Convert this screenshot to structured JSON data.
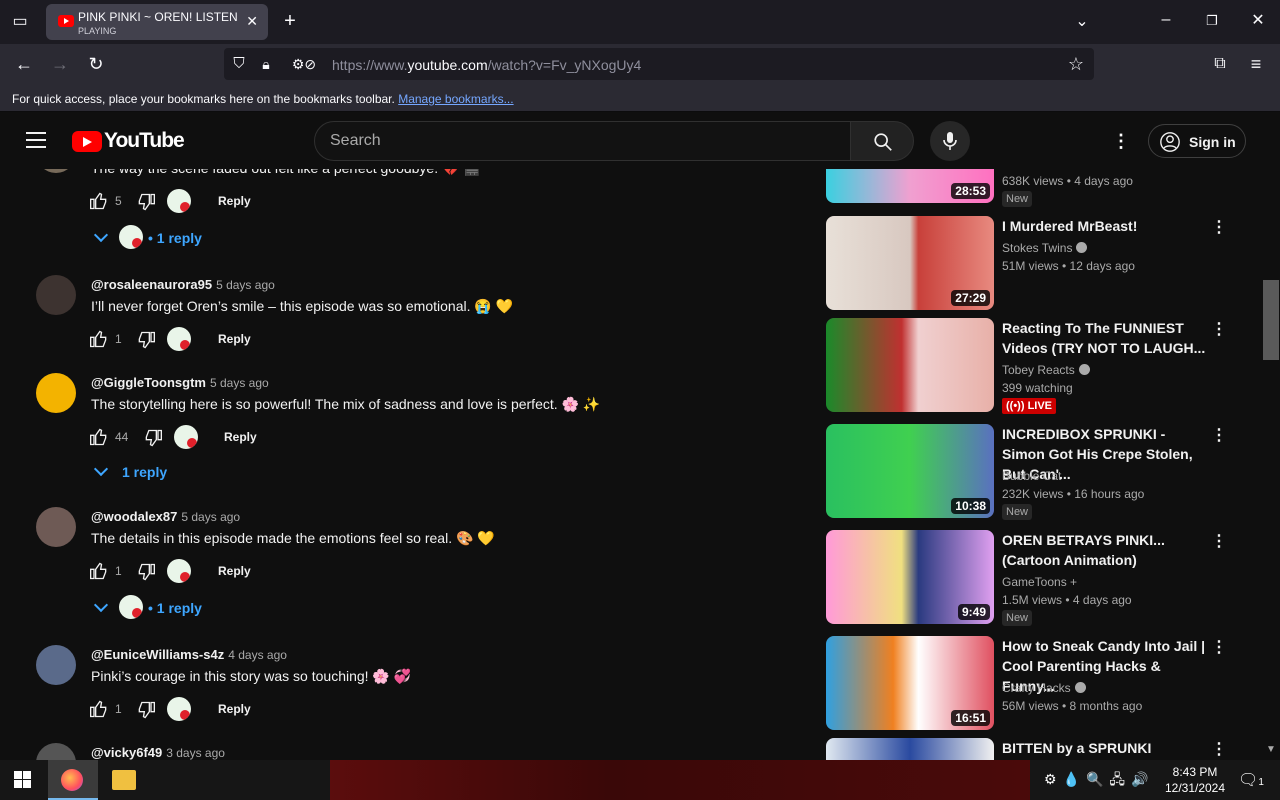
{
  "browser": {
    "tab": {
      "title": "PINK PINKI ~ OREN! LISTEN To",
      "status": "PLAYING"
    },
    "url": {
      "prefix": "https://www.",
      "domain": "youtube.com",
      "path": "/watch?v=Fv_yNXogUy4"
    },
    "bookmarks": {
      "text": "For quick access, place your bookmarks here on the bookmarks toolbar.",
      "link": "Manage bookmarks..."
    }
  },
  "header": {
    "logo": "YouTube",
    "search_placeholder": "Search",
    "signin": "Sign in"
  },
  "comments": [
    {
      "text": "The way the scene faded out felt like a perfect goodbye. 💔 🎬",
      "likes": "5",
      "reply_label": "Reply",
      "replies": "1 reply"
    },
    {
      "handle": "@rosaleenaurora95",
      "ago": "5 days ago",
      "text": "I’ll never forget Oren’s smile – this episode was so emotional. 😭 💛",
      "likes": "1",
      "reply_label": "Reply"
    },
    {
      "handle": "@GiggleToonsgtm",
      "ago": "5 days ago",
      "text": "The storytelling here is so powerful! The mix of sadness and love is perfect. 🌸 ✨",
      "likes": "44",
      "reply_label": "Reply",
      "replies": "1 reply"
    },
    {
      "handle": "@woodalex87",
      "ago": "5 days ago",
      "text": "The details in this episode made the emotions feel so real. 🎨 💛",
      "likes": "1",
      "reply_label": "Reply",
      "replies": "1 reply"
    },
    {
      "handle": "@EuniceWilliams-s4z",
      "ago": "4 days ago",
      "text": "Pinki’s courage in this story was so touching! 🌸 💞",
      "likes": "1",
      "reply_label": "Reply"
    },
    {
      "handle": "@vicky6f49",
      "ago": "3 days ago"
    }
  ],
  "sidebar": [
    {
      "duration": "28:53",
      "meta": "638K views • 4 days ago",
      "badge": "New"
    },
    {
      "title": "I Murdered MrBeast!",
      "channel": "Stokes Twins",
      "meta": "51M views • 12 days ago",
      "duration": "27:29"
    },
    {
      "title": "Reacting To The FUNNIEST Videos (TRY NOT TO LAUGH...",
      "channel": "Tobey Reacts",
      "meta": "399 watching",
      "live": "LIVE"
    },
    {
      "title": "INCREDIBOX SPRUNKI - Simon Got His Crepe Stolen, But Can'...",
      "channel": "Bubble Cat",
      "meta": "232K views • 16 hours ago",
      "duration": "10:38",
      "badge": "New"
    },
    {
      "title": "OREN BETRAYS PINKI... (Cartoon Animation)",
      "channel": "GameToons +",
      "meta": "1.5M views • 4 days ago",
      "duration": "9:49",
      "badge": "New"
    },
    {
      "title": "How to Sneak Candy Into Jail | Cool Parenting Hacks & Funny...",
      "channel": "Crafty Hacks",
      "meta": "56M views • 8 months ago",
      "duration": "16:51"
    },
    {
      "title": "BITTEN by a SPRUNKI SPIDER"
    }
  ],
  "taskbar": {
    "time": "8:43 PM",
    "date": "12/31/2024",
    "notif": "1"
  }
}
